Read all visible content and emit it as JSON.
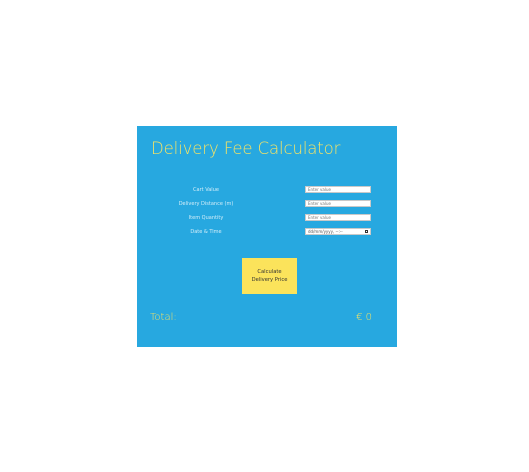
{
  "calculator": {
    "title": "Delivery Fee Calculator",
    "fields": [
      {
        "label": "Cart Value",
        "placeholder": "Enter value"
      },
      {
        "label": "Delivery Distance (m)",
        "placeholder": "Enter value"
      },
      {
        "label": "Item Quantity",
        "placeholder": "Enter value"
      },
      {
        "label": "Date & Time",
        "value": "dd/mm/yyyy, --:--"
      }
    ],
    "button": {
      "line1": "Calculate",
      "line2": "Delivery Price"
    },
    "total": {
      "label": "Total:",
      "value": "€ 0"
    }
  },
  "icons": {
    "date_picker": "calendar-icon"
  },
  "colors": {
    "card_background": "#27a8e0",
    "accent_yellow": "#f7e463",
    "button_background": "#fbe35b",
    "page_background": "#ffffff"
  }
}
